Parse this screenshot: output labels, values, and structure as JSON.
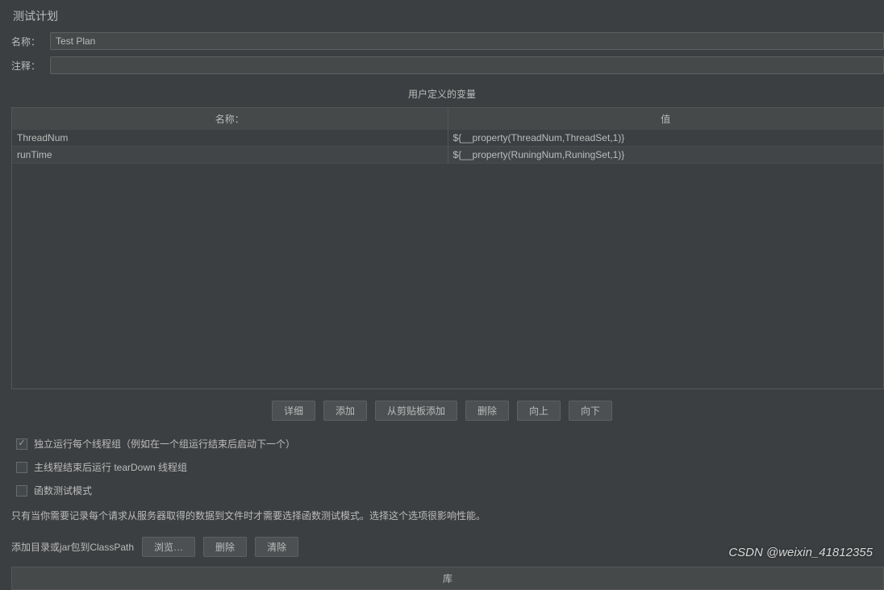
{
  "title": "测试计划",
  "nameField": {
    "label": "名称：",
    "value": "Test Plan"
  },
  "commentField": {
    "label": "注释：",
    "value": ""
  },
  "variablesSection": {
    "header": "用户定义的变量",
    "columns": {
      "name": "名称：",
      "value": "值"
    },
    "rows": [
      {
        "name": "ThreadNum",
        "value": "${__property(ThreadNum,ThreadSet,1)}"
      },
      {
        "name": "runTime",
        "value": "${__property(RuningNum,RuningSet,1)}"
      }
    ]
  },
  "variableButtons": {
    "detail": "详细",
    "add": "添加",
    "addFromClipboard": "从剪贴板添加",
    "delete": "删除",
    "up": "向上",
    "down": "向下"
  },
  "checkboxes": {
    "serialize": "独立运行每个线程组（例如在一个组运行结束后启动下一个）",
    "teardown": "主线程结束后运行 tearDown 线程组",
    "functional": "函数测试模式"
  },
  "functionalNote": "只有当你需要记录每个请求从服务器取得的数据到文件时才需要选择函数测试模式。选择这个选项很影响性能。",
  "classpath": {
    "label": "添加目录或jar包到ClassPath",
    "browse": "浏览…",
    "delete": "删除",
    "clear": "清除",
    "libraryHeader": "库"
  },
  "watermark": "CSDN @weixin_41812355"
}
